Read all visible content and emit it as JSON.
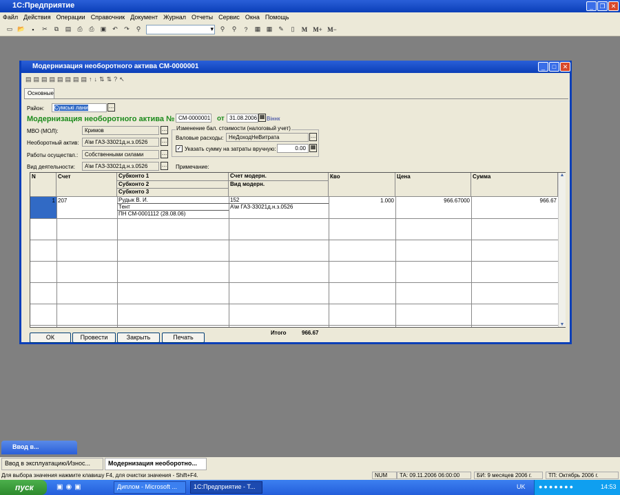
{
  "app": {
    "title": "1С:Предприятие"
  },
  "menu": [
    "Файл",
    "Действия",
    "Операции",
    "Справочник",
    "Документ",
    "Журнал",
    "Отчеты",
    "Сервис",
    "Окна",
    "Помощь"
  ],
  "toolbar": {
    "m": "M",
    "mplus": "M+",
    "mminus": "M−"
  },
  "doc": {
    "title": "Модернизация необоротного актива  СМ-0000001",
    "tab": "Основные",
    "rayon_label": "Район:",
    "rayon_value": "Сумські лани",
    "heading": "Модернизация необоротного актива №",
    "number": "СМ-0000001",
    "ot": "от",
    "date": "31.08.2006",
    "author": "Віннк",
    "mvo_label": "МВО (МОЛ):",
    "mvo_value": "Кримов",
    "asset_label": "Необоротный актив:",
    "asset_value": "А\\м ГАЗ-33021д.н.з.0526",
    "works_label": "Работы осуществл.:",
    "works_value": "Собственными силами",
    "activity_label": "Вид деятельности:",
    "activity_value": "А\\м ГАЗ-33021д.н.з.0526",
    "group_label": "Изменение бал. стоимости (налоговый учет)",
    "gross_label": "Валовые расходы:",
    "gross_value": "НеДоходНеВитрата",
    "manual_label": "Указать сумму на затраты вручную:",
    "manual_checked": true,
    "manual_value": "0.00",
    "note_label": "Примечание:"
  },
  "table": {
    "headers": {
      "n": "N",
      "account": "Счет",
      "sub1": "Субконто 1",
      "sub2": "Субконто 2",
      "sub3": "Субконто 3",
      "acc_mod": "Счет модерн.",
      "kind_mod": "Вид модерн.",
      "qty": "Кво",
      "price": "Цена",
      "sum": "Сумма"
    },
    "rows": [
      {
        "n": "1",
        "account": "207",
        "sub1": "Рудык В. И.",
        "sub2": "Тент",
        "sub3": "ПН СМ-0001112 (28.08.06)",
        "acc_mod": "152",
        "kind_mod": "А\\м ГАЗ-33021д.н.з.0526",
        "qty": "1.000",
        "price": "966.67000",
        "sum": "966.67"
      }
    ]
  },
  "footer": {
    "ok": "ОК",
    "post": "Провести",
    "close": "Закрыть",
    "print": "Печать",
    "total_label": "Итого",
    "total": "966.67"
  },
  "minimized": {
    "label": "Ввод в..."
  },
  "windows_bar": [
    "Ввод в эксплуатацию/Износ...",
    "Модернизация необоротно..."
  ],
  "status": {
    "hint": "Для выбора значения нажмите клавишу F4, для очистки значения - Shift+F4.",
    "num": "NUM",
    "ta": "ТА: 09.11.2006  06:00:00",
    "bi": "БИ: 9 месяцев 2006 г.",
    "tp": "ТП: Октябрь 2006 г."
  },
  "taskbar": {
    "start": "пуск",
    "tasks": [
      "Диплом - Microsoft ...",
      "1С:Предприятие - Т..."
    ],
    "lang": "UK",
    "clock": "14:53"
  }
}
